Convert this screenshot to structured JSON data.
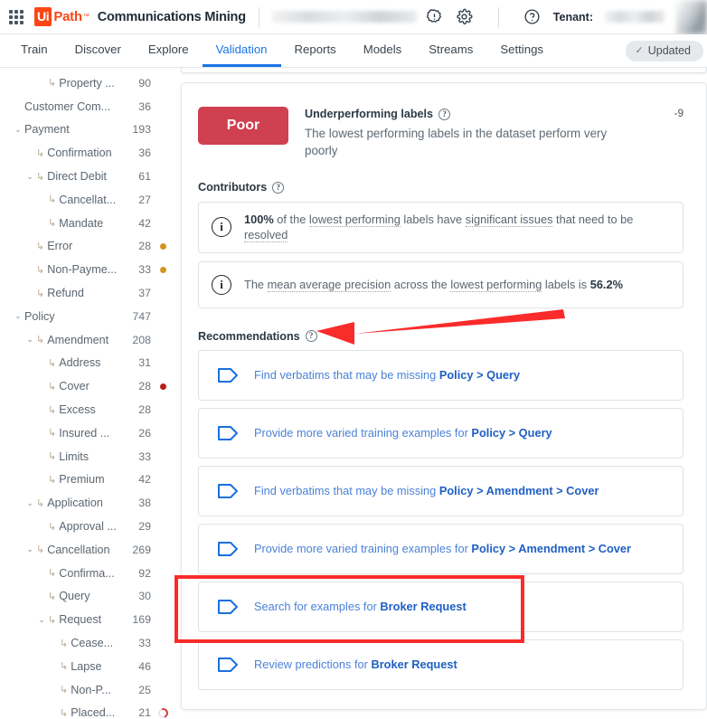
{
  "header": {
    "app_menu_icon": "waffle-grid-icon",
    "logo_ui": "Ui",
    "logo_path": "Path",
    "app_title": "Communications Mining",
    "alert_icon": "alert-gear-icon",
    "settings_icon": "gear-icon",
    "help_icon": "help-circle-icon",
    "tenant_label": "Tenant:",
    "avatar": "user-avatar"
  },
  "nav": {
    "tabs": [
      {
        "label": "Train",
        "active": false
      },
      {
        "label": "Discover",
        "active": false
      },
      {
        "label": "Explore",
        "active": false
      },
      {
        "label": "Validation",
        "active": true
      },
      {
        "label": "Reports",
        "active": false
      },
      {
        "label": "Models",
        "active": false
      },
      {
        "label": "Streams",
        "active": false
      },
      {
        "label": "Settings",
        "active": false
      }
    ],
    "status_badge": {
      "label": "Updated",
      "check": "✓",
      "icon": "check-icon"
    }
  },
  "sidebar": {
    "items": [
      {
        "label": "Property ...",
        "count": "90",
        "depth": 3,
        "caret": "",
        "arrow": true,
        "dot": ""
      },
      {
        "label": "Customer Com...",
        "count": "36",
        "depth": 1,
        "caret": "",
        "arrow": false,
        "dot": ""
      },
      {
        "label": "Payment",
        "count": "193",
        "depth": 1,
        "caret": "⌄",
        "arrow": false,
        "dot": ""
      },
      {
        "label": "Confirmation",
        "count": "36",
        "depth": 2,
        "caret": "",
        "arrow": true,
        "dot": ""
      },
      {
        "label": "Direct Debit",
        "count": "61",
        "depth": 2,
        "caret": "⌄",
        "arrow": true,
        "dot": ""
      },
      {
        "label": "Cancellat...",
        "count": "27",
        "depth": 3,
        "caret": "",
        "arrow": true,
        "dot": ""
      },
      {
        "label": "Mandate",
        "count": "42",
        "depth": 3,
        "caret": "",
        "arrow": true,
        "dot": ""
      },
      {
        "label": "Error",
        "count": "28",
        "depth": 2,
        "caret": "",
        "arrow": true,
        "dot": "#d4941f"
      },
      {
        "label": "Non-Payme...",
        "count": "33",
        "depth": 2,
        "caret": "",
        "arrow": true,
        "dot": "#d4941f"
      },
      {
        "label": "Refund",
        "count": "37",
        "depth": 2,
        "caret": "",
        "arrow": true,
        "dot": ""
      },
      {
        "label": "Policy",
        "count": "747",
        "depth": 1,
        "caret": "⌄",
        "arrow": false,
        "dot": ""
      },
      {
        "label": "Amendment",
        "count": "208",
        "depth": 2,
        "caret": "⌄",
        "arrow": true,
        "dot": ""
      },
      {
        "label": "Address",
        "count": "31",
        "depth": 3,
        "caret": "",
        "arrow": true,
        "dot": ""
      },
      {
        "label": "Cover",
        "count": "28",
        "depth": 3,
        "caret": "",
        "arrow": true,
        "dot": "#b91c1c"
      },
      {
        "label": "Excess",
        "count": "28",
        "depth": 3,
        "caret": "",
        "arrow": true,
        "dot": ""
      },
      {
        "label": "Insured ...",
        "count": "26",
        "depth": 3,
        "caret": "",
        "arrow": true,
        "dot": ""
      },
      {
        "label": "Limits",
        "count": "33",
        "depth": 3,
        "caret": "",
        "arrow": true,
        "dot": ""
      },
      {
        "label": "Premium",
        "count": "42",
        "depth": 3,
        "caret": "",
        "arrow": true,
        "dot": ""
      },
      {
        "label": "Application",
        "count": "38",
        "depth": 2,
        "caret": "⌄",
        "arrow": true,
        "dot": ""
      },
      {
        "label": "Approval ...",
        "count": "29",
        "depth": 3,
        "caret": "",
        "arrow": true,
        "dot": ""
      },
      {
        "label": "Cancellation",
        "count": "269",
        "depth": 2,
        "caret": "⌄",
        "arrow": true,
        "dot": ""
      },
      {
        "label": "Confirma...",
        "count": "92",
        "depth": 3,
        "caret": "",
        "arrow": true,
        "dot": ""
      },
      {
        "label": "Query",
        "count": "30",
        "depth": 3,
        "caret": "",
        "arrow": true,
        "dot": ""
      },
      {
        "label": "Request",
        "count": "169",
        "depth": 3,
        "caret": "⌄",
        "arrow": true,
        "dot": ""
      },
      {
        "label": "Cease...",
        "count": "33",
        "depth": 4,
        "caret": "",
        "arrow": true,
        "dot": ""
      },
      {
        "label": "Lapse",
        "count": "46",
        "depth": 4,
        "caret": "",
        "arrow": true,
        "dot": ""
      },
      {
        "label": "Non-P...",
        "count": "25",
        "depth": 4,
        "caret": "",
        "arrow": true,
        "dot": ""
      },
      {
        "label": "Placed...",
        "count": "21",
        "depth": 4,
        "caret": "",
        "arrow": true,
        "dot": "donut"
      }
    ]
  },
  "main": {
    "score": {
      "rating": "Poor",
      "rating_color": "#cf4050",
      "heading": "Underperforming labels",
      "description": "The lowest performing labels in the dataset perform very poorly",
      "value": "-9",
      "help_icon": "help-circle-icon"
    },
    "contributors": {
      "label": "Contributors",
      "help_icon": "help-circle-icon",
      "items": [
        {
          "icon": "info-icon",
          "parts": [
            {
              "text": "100%",
              "style": "bold"
            },
            {
              "text": " of the ",
              "style": "plain"
            },
            {
              "text": "lowest performing",
              "style": "dotted"
            },
            {
              "text": " labels have ",
              "style": "plain"
            },
            {
              "text": "significant issues",
              "style": "dotted"
            },
            {
              "text": " that need to be ",
              "style": "plain"
            },
            {
              "text": "resolved",
              "style": "dotted"
            }
          ]
        },
        {
          "icon": "info-icon",
          "parts": [
            {
              "text": "The ",
              "style": "plain"
            },
            {
              "text": "mean average precision",
              "style": "dotted"
            },
            {
              "text": " across the ",
              "style": "plain"
            },
            {
              "text": "lowest performing",
              "style": "dotted"
            },
            {
              "text": " labels is ",
              "style": "plain"
            },
            {
              "text": "56.2%",
              "style": "bold"
            }
          ]
        }
      ]
    },
    "recommendations": {
      "label": "Recommendations",
      "help_icon": "help-circle-icon",
      "items": [
        {
          "icon": "tag-icon",
          "prefix": "Find verbatims that may be missing ",
          "target": "Policy > Query",
          "highlighted": false
        },
        {
          "icon": "tag-icon",
          "prefix": "Provide more varied training examples for ",
          "target": "Policy > Query",
          "highlighted": false
        },
        {
          "icon": "tag-icon",
          "prefix": "Find verbatims that may be missing ",
          "target": "Policy > Amendment > Cover",
          "highlighted": false
        },
        {
          "icon": "tag-icon",
          "prefix": "Provide more varied training examples for ",
          "target": "Policy > Amendment > Cover",
          "highlighted": false
        },
        {
          "icon": "tag-icon",
          "prefix": "Search for examples for ",
          "target": "Broker Request",
          "highlighted": true
        },
        {
          "icon": "tag-icon",
          "prefix": "Review predictions for ",
          "target": "Broker Request",
          "highlighted": false
        }
      ]
    }
  },
  "annotations": {
    "arrow_color": "#fa2b2b",
    "box_color": "#fa2b2b"
  }
}
